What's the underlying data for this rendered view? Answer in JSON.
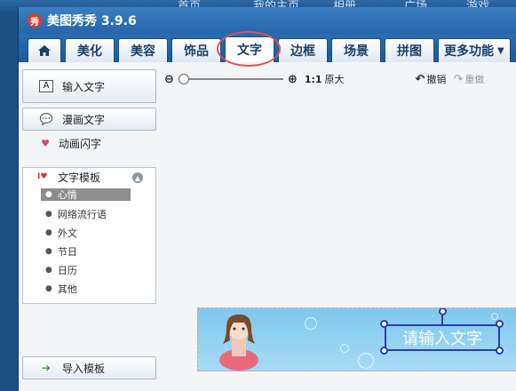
{
  "background_tabs": [
    "首页",
    "我的主页",
    "相册",
    "广场",
    "游戏"
  ],
  "app": {
    "logo_text": "秀",
    "title": "美图秀秀 3.9.6"
  },
  "tabs": [
    {
      "label": "美化"
    },
    {
      "label": "美容"
    },
    {
      "label": "饰品"
    },
    {
      "label": "文字",
      "active": true
    },
    {
      "label": "边框"
    },
    {
      "label": "场景"
    },
    {
      "label": "拼图"
    }
  ],
  "more_tab": {
    "label": "更多功能"
  },
  "sidebar": {
    "input_text": "输入文字",
    "comic_text": "漫画文字",
    "animated_text": "动画闪字",
    "template": {
      "title": "文字模板",
      "items": [
        "心情",
        "网络流行语",
        "外文",
        "节日",
        "日历",
        "其他"
      ],
      "selected": "心情"
    },
    "import_template": "导入模板"
  },
  "toolbar": {
    "zoom_level": 0,
    "ratio_label": "1:1",
    "original_label": "原大",
    "undo_label": "撤销",
    "redo_label": "重做"
  },
  "canvas": {
    "text": "请输入文字"
  },
  "colors": {
    "title_bar": "#2f74b9",
    "accent": "#2c3fa8",
    "annotation_circle": "#d9525c"
  }
}
